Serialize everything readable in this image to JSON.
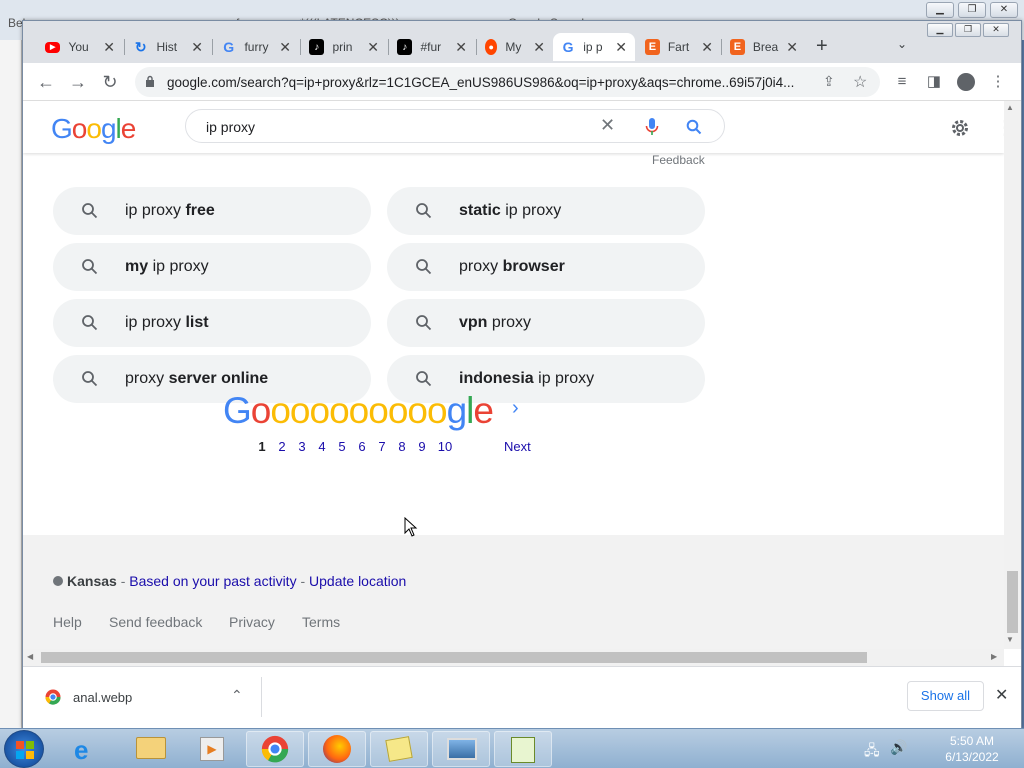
{
  "background_tabs": [
    "Bel...",
    "f...",
    "*(((LATENCESC)))...",
    "...",
    "...Google Search"
  ],
  "browser": {
    "tabs": [
      {
        "title": "You",
        "icon": "youtube-icon"
      },
      {
        "title": "Hist",
        "icon": "history-icon"
      },
      {
        "title": "furry",
        "icon": "google-icon"
      },
      {
        "title": "prin",
        "icon": "tiktok-icon"
      },
      {
        "title": "#fur",
        "icon": "tiktok-icon"
      },
      {
        "title": "My",
        "icon": "reddit-icon"
      },
      {
        "title": "ip p",
        "icon": "google-icon",
        "active": true
      },
      {
        "title": "Fart",
        "icon": "etsy-icon"
      },
      {
        "title": "Brea",
        "icon": "etsy-icon"
      }
    ],
    "new_tab": "+",
    "url": "google.com/search?q=ip+proxy&rlz=1C1GCEA_enUS986US986&oq=ip+proxy&aqs=chrome..69i57j0i4..."
  },
  "search": {
    "logo": "Google",
    "query": "ip proxy",
    "feedback": "Feedback"
  },
  "related": [
    {
      "pre": "ip proxy ",
      "bold": "free",
      "post": ""
    },
    {
      "pre": "",
      "bold": "static",
      "post": " ip proxy"
    },
    {
      "pre": "",
      "bold": "my",
      "post": " ip proxy"
    },
    {
      "pre": "proxy ",
      "bold": "browser",
      "post": ""
    },
    {
      "pre": "ip proxy ",
      "bold": "list",
      "post": ""
    },
    {
      "pre": "",
      "bold": "vpn",
      "post": " proxy"
    },
    {
      "pre": "proxy ",
      "bold": "server online",
      "post": ""
    },
    {
      "pre": "",
      "bold": "indonesia",
      "post": " ip proxy"
    }
  ],
  "pagination": {
    "current": "1",
    "pages": [
      "2",
      "3",
      "4",
      "5",
      "6",
      "7",
      "8",
      "9",
      "10"
    ],
    "next": "Next"
  },
  "footer": {
    "location": "Kansas",
    "sep": " - ",
    "based_on": "Based on your past activity",
    "update": "Update location",
    "links": [
      "Help",
      "Send feedback",
      "Privacy",
      "Terms"
    ]
  },
  "downloads": {
    "file": "anal.webp",
    "show_all": "Show all"
  },
  "taskbar": {
    "time": "5:50 AM",
    "date": "6/13/2022"
  },
  "colors": {
    "google_blue": "#4285F4",
    "google_red": "#EA4335",
    "google_yellow": "#FBBC05",
    "google_green": "#34A853",
    "link": "#1a0dab"
  }
}
